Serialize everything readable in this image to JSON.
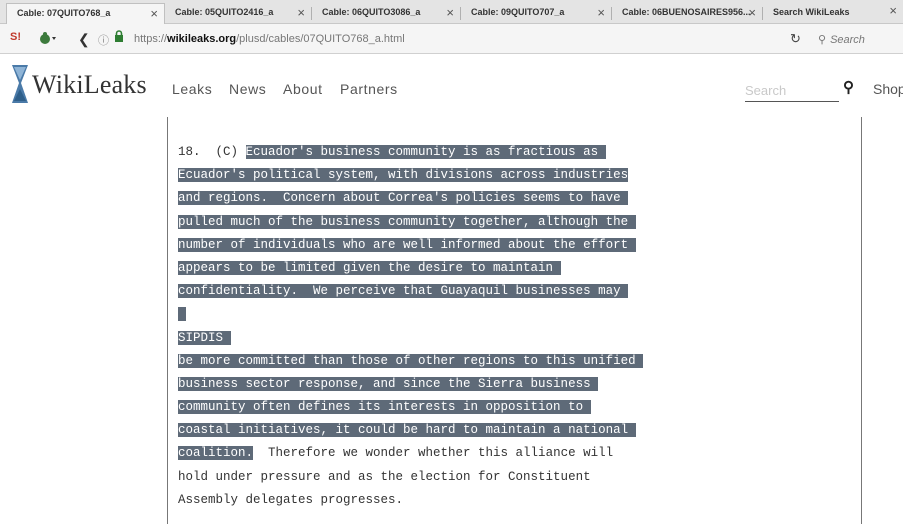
{
  "tabs": [
    {
      "label": "Cable: 07QUITO768_a",
      "active": true
    },
    {
      "label": "Cable: 05QUITO2416_a",
      "active": false
    },
    {
      "label": "Cable: 06QUITO3086_a",
      "active": false
    },
    {
      "label": "Cable: 09QUITO707_a",
      "active": false
    },
    {
      "label": "Cable: 06BUENOSAIRES956...",
      "active": false
    },
    {
      "label": "Search WikiLeaks",
      "active": false
    }
  ],
  "address_bar": {
    "url_prefix": "https://",
    "url_domain": "wikileaks.org",
    "url_path": "/plusd/cables/07QUITO768_a.html",
    "search_placeholder": "Search"
  },
  "site": {
    "logo_text": "WikiLeaks",
    "menu": [
      "Leaks",
      "News",
      "About",
      "Partners"
    ],
    "search_placeholder": "Search",
    "shop_label": "Shop"
  },
  "cable": {
    "lines": [
      {
        "plain": "18.  (C) ",
        "hl": "Ecuador's business community is as fractious as "
      },
      {
        "plain": "",
        "hl": "Ecuador's political system, with divisions across industries"
      },
      {
        "plain": "",
        "hl": "and regions.  Concern about Correa's policies seems to have "
      },
      {
        "plain": "",
        "hl": "pulled much of the business community together, although the "
      },
      {
        "plain": "",
        "hl": "number of individuals who are well informed about the effort "
      },
      {
        "plain": "",
        "hl": "appears to be limited given the desire to maintain "
      },
      {
        "plain": "",
        "hl": "confidentiality.  We perceive that Guayaquil businesses may "
      },
      {
        "plain": "",
        "hl": " "
      },
      {
        "plain": "",
        "hl": "SIPDIS "
      },
      {
        "plain": "",
        "hl": "be more committed than those of other regions to this unified "
      },
      {
        "plain": "",
        "hl": "business sector response, and since the Sierra business "
      },
      {
        "plain": "",
        "hl": "community often defines its interests in opposition to "
      },
      {
        "plain": "",
        "hl": "coastal initiatives, it could be hard to maintain a national "
      },
      {
        "plain_after": "  Therefore we wonder whether this alliance will",
        "hl": "coalition."
      },
      {
        "plain": "hold under pressure and as the election for Constituent",
        "hl": ""
      },
      {
        "plain": "Assembly delegates progresses.",
        "hl": ""
      }
    ]
  }
}
